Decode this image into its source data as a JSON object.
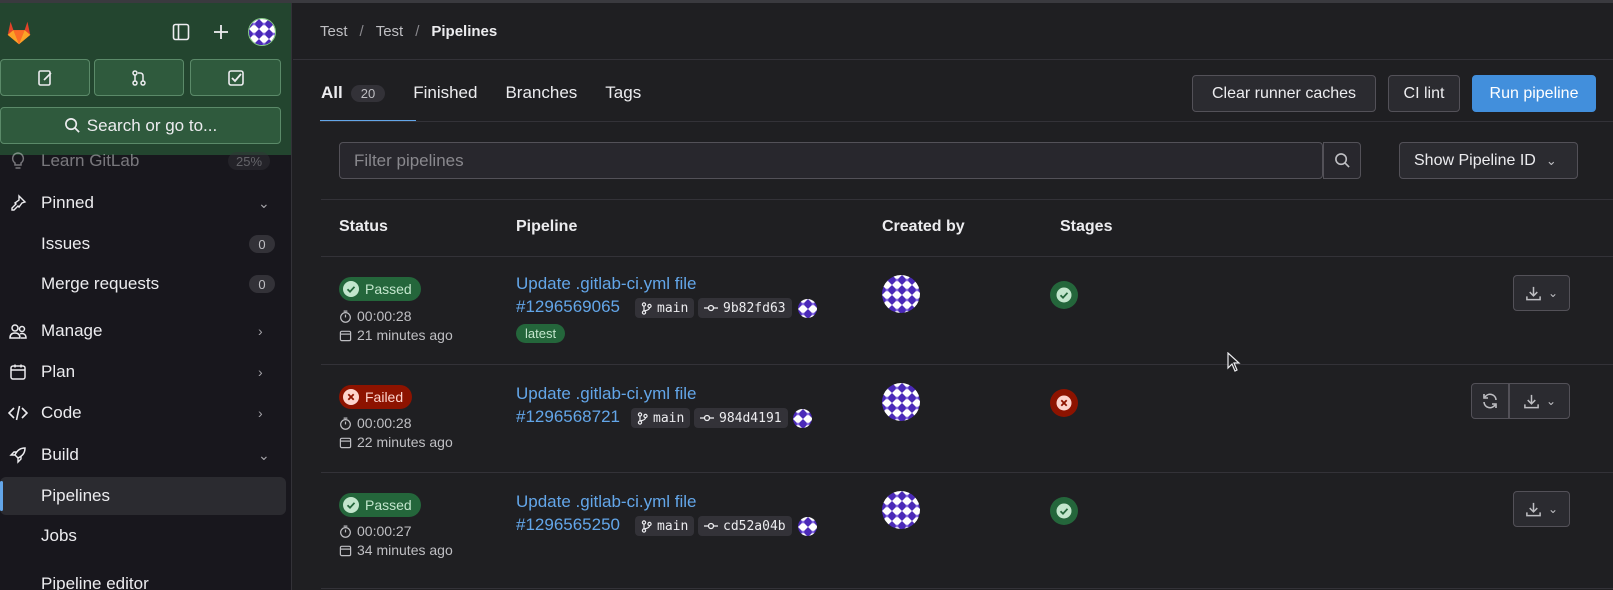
{
  "breadcrumb": {
    "item1": "Test",
    "item2": "Test",
    "current": "Pipelines"
  },
  "sidebar": {
    "search_label": "Search or go to...",
    "learn": {
      "label": "Learn GitLab",
      "progress": "25%"
    },
    "pinned": {
      "label": "Pinned"
    },
    "items": [
      {
        "label": "Issues",
        "count": "0"
      },
      {
        "label": "Merge requests",
        "count": "0"
      },
      {
        "label": "Manage"
      },
      {
        "label": "Plan"
      },
      {
        "label": "Code"
      },
      {
        "label": "Build"
      },
      {
        "label": "Pipelines"
      },
      {
        "label": "Jobs"
      },
      {
        "label": "Pipeline editor"
      }
    ]
  },
  "tabs": [
    {
      "label": "All",
      "count": "20"
    },
    {
      "label": "Finished"
    },
    {
      "label": "Branches"
    },
    {
      "label": "Tags"
    }
  ],
  "actions": {
    "clear_caches": "Clear runner caches",
    "ci_lint": "CI lint",
    "run_pipeline": "Run pipeline"
  },
  "filter": {
    "placeholder": "Filter pipelines",
    "show_id": "Show Pipeline ID"
  },
  "table": {
    "headers": {
      "status": "Status",
      "pipeline": "Pipeline",
      "created_by": "Created by",
      "stages": "Stages"
    },
    "rows": [
      {
        "status": "Passed",
        "duration": "00:00:28",
        "finished": "21 minutes ago",
        "title": "Update .gitlab-ci.yml file",
        "id": "#1296569065",
        "branch": "main",
        "commit": "9b82fd63",
        "tag": "latest"
      },
      {
        "status": "Failed",
        "duration": "00:00:28",
        "finished": "22 minutes ago",
        "title": "Update .gitlab-ci.yml file",
        "id": "#1296568721",
        "branch": "main",
        "commit": "984d4191"
      },
      {
        "status": "Passed",
        "duration": "00:00:27",
        "finished": "34 minutes ago",
        "title": "Update .gitlab-ci.yml file",
        "id": "#1296565250",
        "branch": "main",
        "commit": "cd52a04b"
      }
    ]
  },
  "colors": {
    "sidebar_header": "#23452f",
    "link": "#63a6e9",
    "passed": "#24663b",
    "failed": "#8d1300",
    "primary": "#428fdc"
  }
}
